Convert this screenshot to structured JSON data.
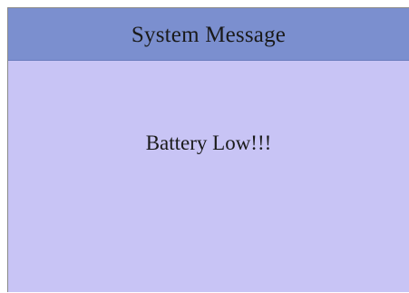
{
  "dialog": {
    "title": "System Message",
    "message": "Battery Low!!!"
  },
  "colors": {
    "title_bar": "#7b8fcf",
    "body_background": "#c8c4f5",
    "text": "#1a1a1a"
  }
}
